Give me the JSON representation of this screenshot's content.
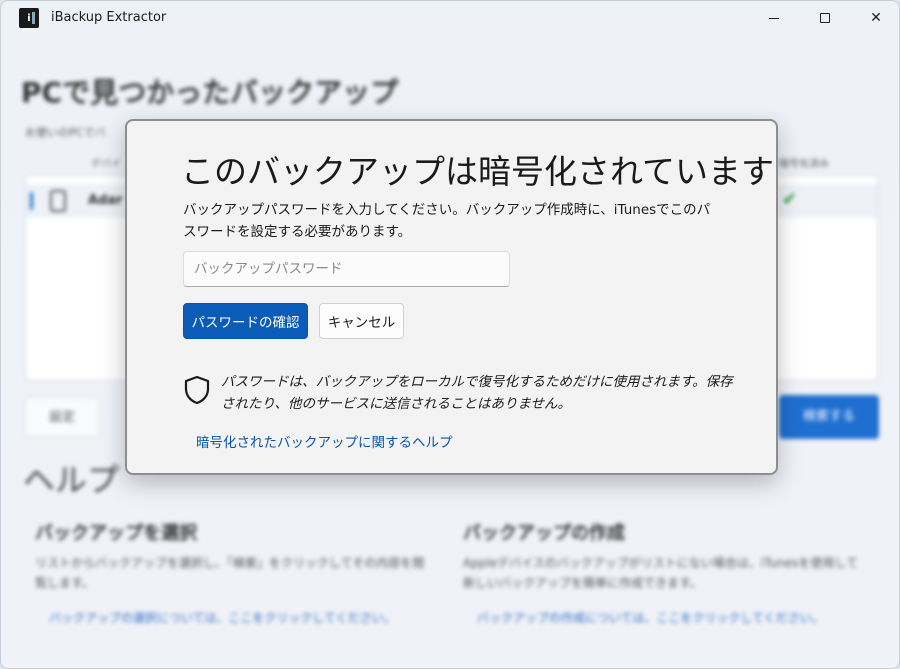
{
  "window": {
    "title": "iBackup Extractor",
    "controls": {
      "minimize": "minimize",
      "maximize": "maximize",
      "close": "close"
    }
  },
  "background": {
    "page_title": "PCで見つかったバックアップ",
    "subtitle": "お使いのPCでバ",
    "columns": {
      "device": "デバイ",
      "encrypted": "暗号化済み"
    },
    "row": {
      "name": "Adar"
    },
    "settings_button": "設定",
    "search_button": "検索する",
    "help": {
      "title": "ヘルプ",
      "cards": [
        {
          "heading": "バックアップを選択",
          "text": "リストからバックアップを選択し、「検索」をクリックしてその内容を閲覧します。",
          "link": "バックアップの選択については、ここをクリックしてください。"
        },
        {
          "heading": "バックアップの作成",
          "text": "Appleデバイスのバックアップがリストにない場合は、iTunesを使用して新しいバックアップを簡単に作成できます。",
          "link": "バックアップの作成については、ここをクリックしてください。"
        }
      ]
    }
  },
  "dialog": {
    "title": "このバックアップは暗号化されています",
    "body": "バックアップパスワードを入力してください。バックアップ作成時に、iTunesでこのパスワードを設定する必要があります。",
    "password": {
      "placeholder": "バックアップパスワード",
      "value": ""
    },
    "confirm_button": "パスワードの確認",
    "cancel_button": "キャンセル",
    "notice": "パスワードは、バックアップをローカルで復号化するためだけに使用されます。保存されたり、他のサービスに送信されることはありません。",
    "help_link": "暗号化されたバックアップに関するヘルプ"
  },
  "colors": {
    "accent": "#0a5cb8",
    "link": "#0a54a8",
    "check": "#2a9d3a"
  }
}
